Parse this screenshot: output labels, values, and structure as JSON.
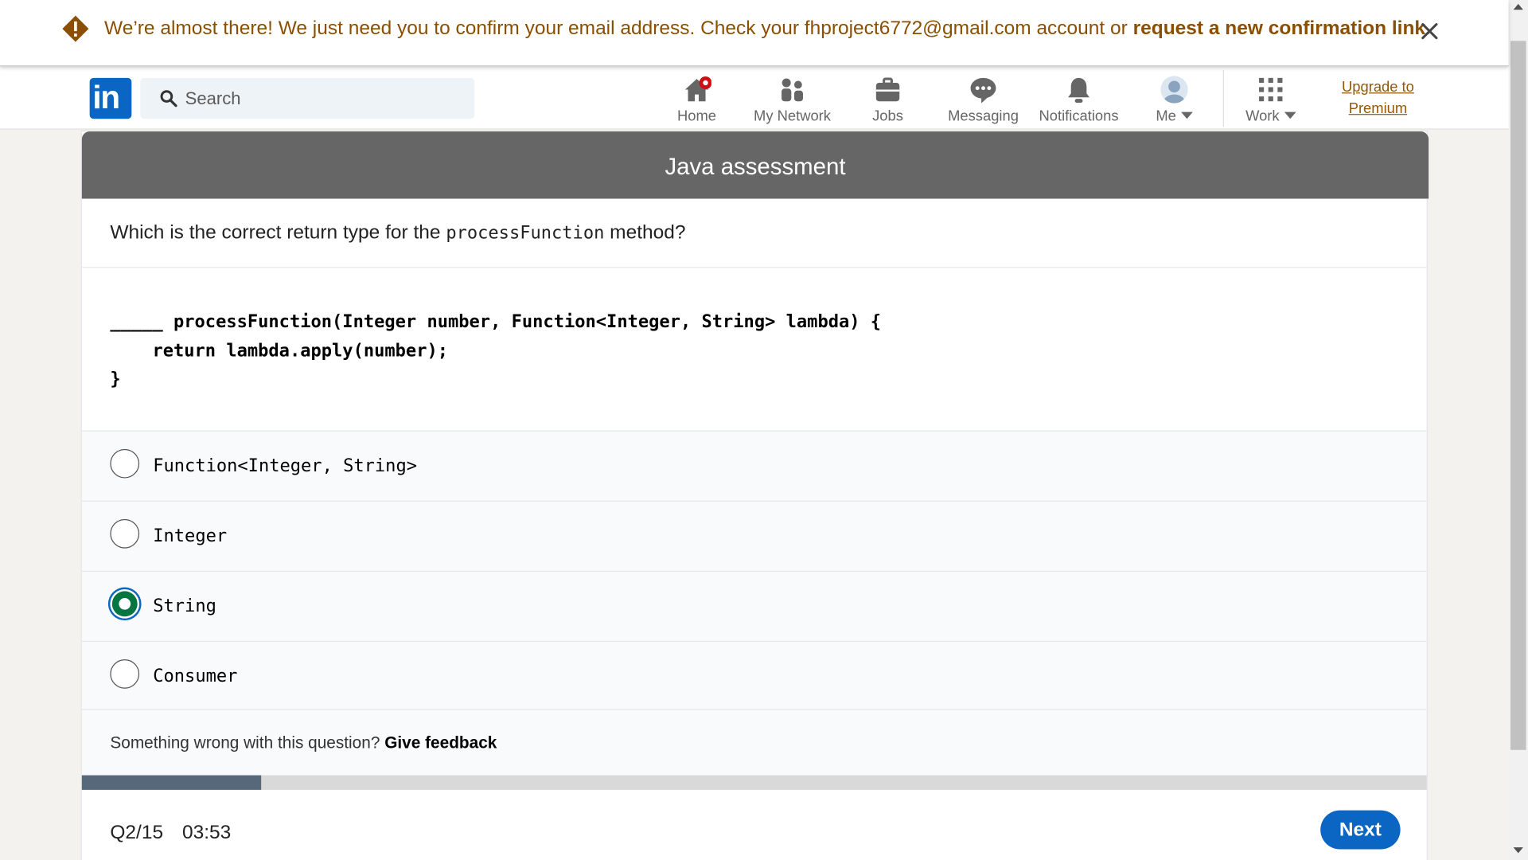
{
  "banner": {
    "message": "We’re almost there! We just need you to confirm your email address. Check your fhproject6772@gmail.com account or ",
    "link": "request a new confirmation link",
    "suffix": ".",
    "icon": "warning-icon",
    "close_icon": "close-icon",
    "text_color": "#8a4f00"
  },
  "nav": {
    "logo": "in",
    "search": {
      "placeholder": "Search",
      "value": ""
    },
    "items": [
      {
        "label": "Home",
        "icon": "home-icon",
        "notification_badge": true
      },
      {
        "label": "My Network",
        "icon": "network-icon"
      },
      {
        "label": "Jobs",
        "icon": "briefcase-icon"
      },
      {
        "label": "Messaging",
        "icon": "chat-icon"
      },
      {
        "label": "Notifications",
        "icon": "bell-icon"
      },
      {
        "label": "Me",
        "icon": "avatar-icon",
        "dropdown": true
      },
      {
        "label": "Work",
        "icon": "grid-icon",
        "dropdown": true
      }
    ],
    "premium_label": "Upgrade to Premium",
    "brand_color": "#0a66c2"
  },
  "assessment": {
    "title": "Java assessment",
    "question": {
      "prefix": "Which is the correct return type for the ",
      "code": "processFunction",
      "suffix": " method?"
    },
    "code_snippet": "_____ processFunction(Integer number, Function<Integer, String> lambda) {\n    return lambda.apply(number);\n}",
    "options": [
      {
        "label": "Function<Integer, String>",
        "selected": false
      },
      {
        "label": "Integer",
        "selected": false
      },
      {
        "label": "String",
        "selected": true
      },
      {
        "label": "Consumer",
        "selected": false
      }
    ],
    "feedback_prompt": "Something wrong with this question? ",
    "feedback_link": "Give feedback",
    "progress_fraction": 0.1333,
    "question_number": "Q2/15",
    "timer": "03:53",
    "next_label": "Next",
    "header_color": "#666666",
    "selected_color": "#057642"
  }
}
